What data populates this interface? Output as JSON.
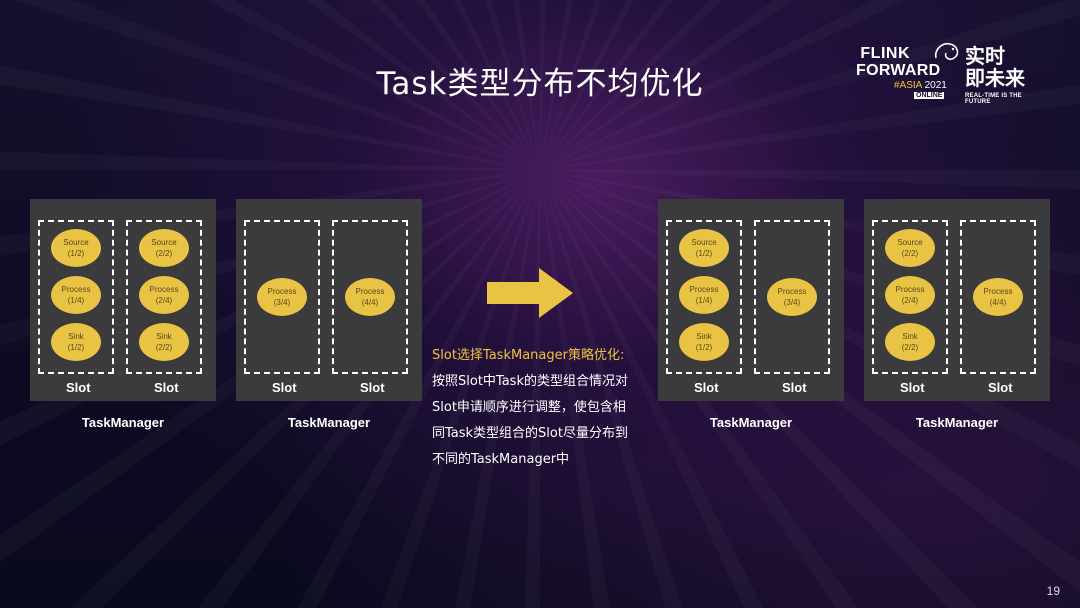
{
  "title": "Task类型分布不均优化",
  "logo": {
    "line1": "FLINK",
    "line2": "FORWARD",
    "asia": "#ASIA",
    "year": "2021",
    "online": "ONLINE",
    "cn_line1": "实时",
    "cn_line2": "即未来",
    "tagline": "REAL-TIME IS THE FUTURE"
  },
  "slot_label": "Slot",
  "tm_label": "TaskManager",
  "before": [
    {
      "slots": [
        [
          "Source (1/2)",
          "Process (1/4)",
          "Sink (1/2)"
        ],
        [
          "Source (2/2)",
          "Process (2/4)",
          "Sink (2/2)"
        ]
      ]
    },
    {
      "slots": [
        [
          "Process (3/4)"
        ],
        [
          "Process (4/4)"
        ]
      ]
    }
  ],
  "after": [
    {
      "slots": [
        [
          "Source (1/2)",
          "Process (1/4)",
          "Sink (1/2)"
        ],
        [
          "Process (3/4)"
        ]
      ]
    },
    {
      "slots": [
        [
          "Source (2/2)",
          "Process (2/4)",
          "Sink (2/2)"
        ],
        [
          "Process (4/4)"
        ]
      ]
    }
  ],
  "description": {
    "heading": "Slot选择TaskManager策略优化:",
    "lines": [
      "按照Slot中Task的类型组合情况对",
      "Slot申请顺序进行调整，使包含相",
      "同Task类型组合的Slot尽量分布到",
      "不同的TaskManager中"
    ]
  },
  "page_number": "19",
  "colors": {
    "accent": "#e8c344",
    "panel": "#3b3b3d",
    "highlight": "#f0c33c"
  }
}
